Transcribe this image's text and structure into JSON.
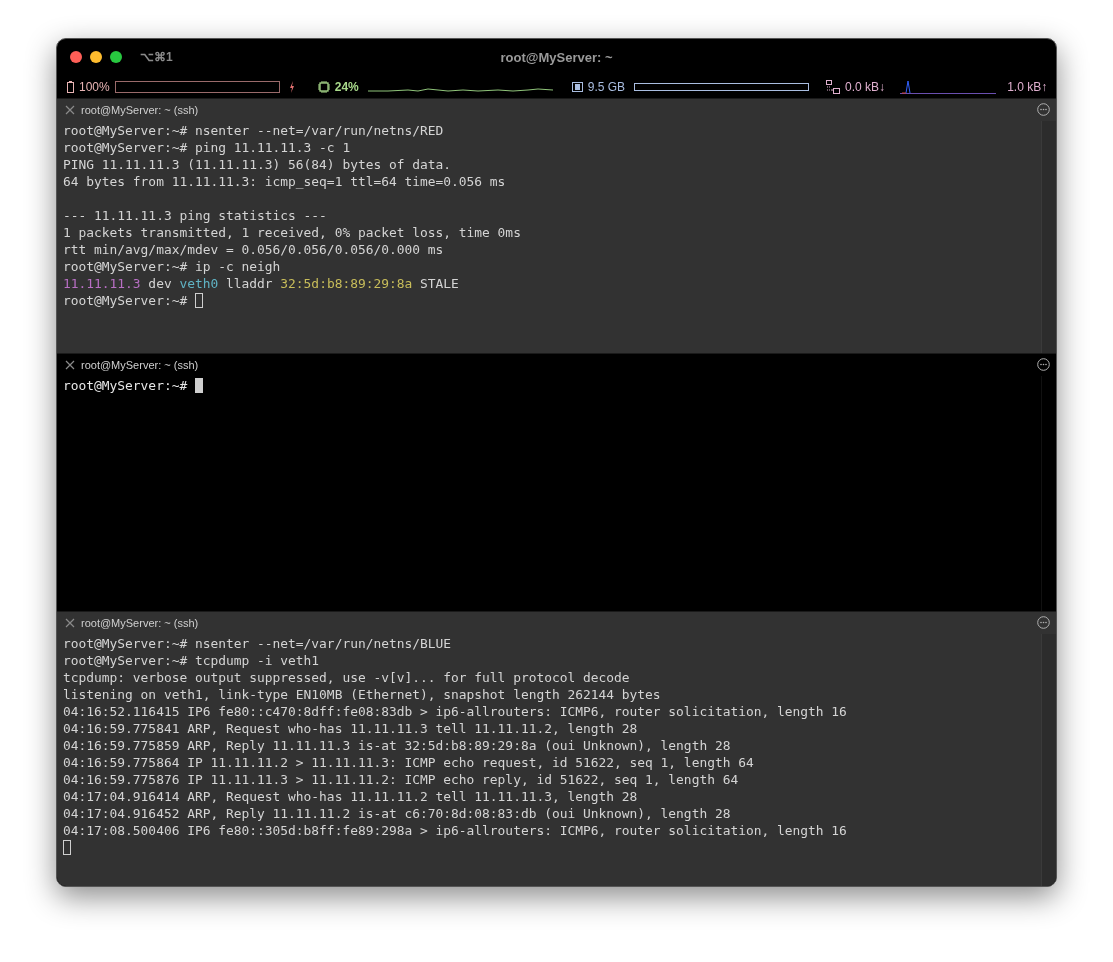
{
  "window": {
    "title": "root@MyServer: ~",
    "shortcut": "⌥⌘1"
  },
  "status_bar": {
    "battery": "100%",
    "cpu": "24%",
    "memory": "9.5 GB",
    "net_down": "0.0 kB↓",
    "net_up": "1.0 kB↑"
  },
  "panes": [
    {
      "title": "root@MyServer: ~ (ssh)",
      "active": false,
      "lines": [
        {
          "kind": "text",
          "segments": [
            {
              "text": "root@MyServer:~# nsenter --net=/var/run/netns/RED"
            }
          ]
        },
        {
          "kind": "text",
          "segments": [
            {
              "text": "root@MyServer:~# ping 11.11.11.3 -c 1"
            }
          ]
        },
        {
          "kind": "text",
          "segments": [
            {
              "text": "PING 11.11.11.3 (11.11.11.3) 56(84) bytes of data."
            }
          ]
        },
        {
          "kind": "text",
          "segments": [
            {
              "text": "64 bytes from 11.11.11.3: icmp_seq=1 ttl=64 time=0.056 ms"
            }
          ]
        },
        {
          "kind": "blank"
        },
        {
          "kind": "text",
          "segments": [
            {
              "text": "--- 11.11.11.3 ping statistics ---"
            }
          ]
        },
        {
          "kind": "text",
          "segments": [
            {
              "text": "1 packets transmitted, 1 received, 0% packet loss, time 0ms"
            }
          ]
        },
        {
          "kind": "text",
          "segments": [
            {
              "text": "rtt min/avg/max/mdev = 0.056/0.056/0.056/0.000 ms"
            }
          ]
        },
        {
          "kind": "text",
          "segments": [
            {
              "text": "root@MyServer:~# ip -c neigh"
            }
          ]
        },
        {
          "kind": "text",
          "segments": [
            {
              "text": "11.11.11.3",
              "color": "#b86fc4"
            },
            {
              "text": " dev "
            },
            {
              "text": "veth0",
              "color": "#5fb3c4"
            },
            {
              "text": " lladdr "
            },
            {
              "text": "32:5d:b8:89:29:8a",
              "color": "#c8bd5a"
            },
            {
              "text": " STALE"
            }
          ]
        },
        {
          "kind": "text",
          "segments": [
            {
              "text": "root@MyServer:~# "
            }
          ]
        }
      ]
    },
    {
      "title": "root@MyServer: ~ (ssh)",
      "active": true,
      "lines": [
        {
          "kind": "text",
          "segments": [
            {
              "text": "root@MyServer:~# "
            }
          ]
        }
      ]
    },
    {
      "title": "root@MyServer: ~ (ssh)",
      "active": false,
      "lines": [
        {
          "kind": "text",
          "segments": [
            {
              "text": "root@MyServer:~# nsenter --net=/var/run/netns/BLUE"
            }
          ]
        },
        {
          "kind": "text",
          "segments": [
            {
              "text": "root@MyServer:~# tcpdump -i veth1"
            }
          ]
        },
        {
          "kind": "text",
          "segments": [
            {
              "text": "tcpdump: verbose output suppressed, use -v[v]... for full protocol decode"
            }
          ]
        },
        {
          "kind": "text",
          "segments": [
            {
              "text": "listening on veth1, link-type EN10MB (Ethernet), snapshot length 262144 bytes"
            }
          ]
        },
        {
          "kind": "text",
          "segments": [
            {
              "text": "04:16:52.116415 IP6 fe80::c470:8dff:fe08:83db > ip6-allrouters: ICMP6, router solicitation, length 16"
            }
          ]
        },
        {
          "kind": "text",
          "segments": [
            {
              "text": "04:16:59.775841 ARP, Request who-has 11.11.11.3 tell 11.11.11.2, length 28"
            }
          ]
        },
        {
          "kind": "text",
          "segments": [
            {
              "text": "04:16:59.775859 ARP, Reply 11.11.11.3 is-at 32:5d:b8:89:29:8a (oui Unknown), length 28"
            }
          ]
        },
        {
          "kind": "text",
          "segments": [
            {
              "text": "04:16:59.775864 IP 11.11.11.2 > 11.11.11.3: ICMP echo request, id 51622, seq 1, length 64"
            }
          ]
        },
        {
          "kind": "text",
          "segments": [
            {
              "text": "04:16:59.775876 IP 11.11.11.3 > 11.11.11.2: ICMP echo reply, id 51622, seq 1, length 64"
            }
          ]
        },
        {
          "kind": "text",
          "segments": [
            {
              "text": "04:17:04.916414 ARP, Request who-has 11.11.11.2 tell 11.11.11.3, length 28"
            }
          ]
        },
        {
          "kind": "text",
          "segments": [
            {
              "text": "04:17:04.916452 ARP, Reply 11.11.11.2 is-at c6:70:8d:08:83:db (oui Unknown), length 28"
            }
          ]
        },
        {
          "kind": "text",
          "segments": [
            {
              "text": "04:17:08.500406 IP6 fe80::305d:b8ff:fe89:298a > ip6-allrouters: ICMP6, router solicitation, length 16"
            }
          ]
        },
        {
          "kind": "blank"
        }
      ]
    }
  ]
}
